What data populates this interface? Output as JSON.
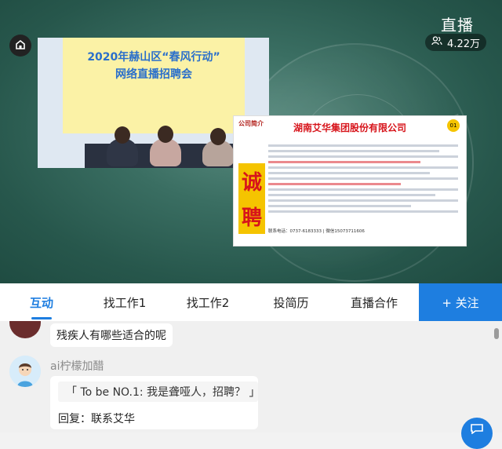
{
  "header": {
    "live_label": "直播",
    "viewer_count": "4.22万"
  },
  "video": {
    "banner_title_line1": "2020年赫山区“春风行动”",
    "banner_title_line2": "网络直播招聘会",
    "recruit_company": "湖南艾华集团股份有限公司",
    "recruit_badge": "公司简介",
    "recruit_number": "01",
    "recruit_big_chars": [
      "诚",
      "聘"
    ],
    "recruit_phone": "联系电话：0737-6183333 | 微信15073711606"
  },
  "tabs": [
    {
      "label": "互动",
      "active": true
    },
    {
      "label": "找工作1",
      "active": false
    },
    {
      "label": "找工作2",
      "active": false
    },
    {
      "label": "投简历",
      "active": false
    },
    {
      "label": "直播合作",
      "active": false
    }
  ],
  "follow_label": "+ 关注",
  "chat": {
    "message1": "残疾人有哪些适合的呢",
    "username2": "ai柠檬加醋",
    "quote2": "「 To be NO.1: 我是聋哑人，招聘？ 」",
    "reply2": "回复：联系艾华"
  },
  "colors": {
    "accent": "#1e7ee0",
    "video_bg": "#2f6357",
    "recruit_red": "#d7141b",
    "recruit_yellow": "#f5c400"
  },
  "icons": {
    "home": "home-icon",
    "viewers": "people-icon",
    "fab": "chat-icon"
  }
}
